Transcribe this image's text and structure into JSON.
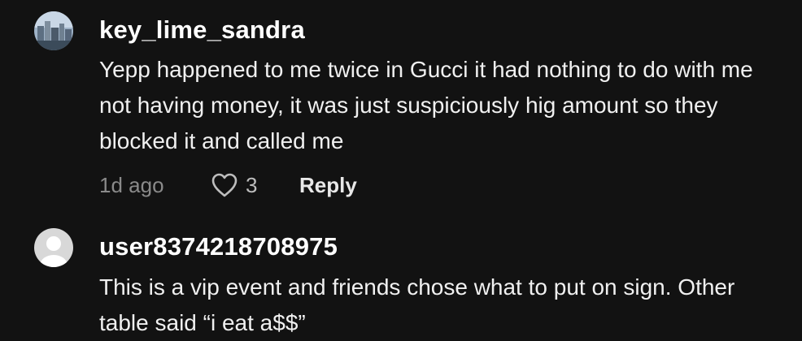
{
  "comments": [
    {
      "username": "key_lime_sandra",
      "text": "Yepp happened to me twice in Gucci it had nothing to do with me not having money, it was just suspiciously hig amount so they blocked it and called me",
      "time": "1d ago",
      "likes": "3",
      "reply_label": "Reply"
    },
    {
      "username": "user8374218708975",
      "text": "This is a vip event and friends chose what to put on sign. Other table said “i eat a$$”"
    }
  ],
  "icons": {
    "like": "heart-outline-icon",
    "default_avatar": "person-silhouette-icon"
  },
  "colors": {
    "background": "#121212",
    "username": "#ffffff",
    "body_text": "#f0f0f0",
    "timestamp": "#8a8a8a"
  }
}
